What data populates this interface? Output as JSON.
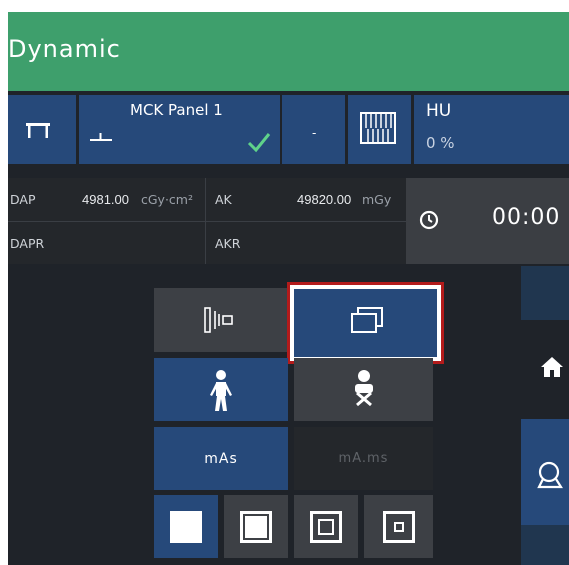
{
  "title": "Dynamic",
  "panel": {
    "name": "MCK Panel 1",
    "dash": "-",
    "hu_label": "HU",
    "hu_value": "0 %"
  },
  "stats": {
    "dap_label": "DAP",
    "dap_value": "4981.00",
    "dap_unit": "cGy·cm²",
    "ak_label": "AK",
    "ak_value": "49820.00",
    "ak_unit": "mGy",
    "dapr_label": "DAPR",
    "akr_label": "AKR"
  },
  "timer": {
    "value": "00:00"
  },
  "buttons": {
    "mas": "mAs",
    "mams": "mA.ms"
  },
  "colors": {
    "accent_green": "#3e9f6c",
    "selected_blue": "#26497a",
    "highlight_red": "#b31b1b"
  }
}
